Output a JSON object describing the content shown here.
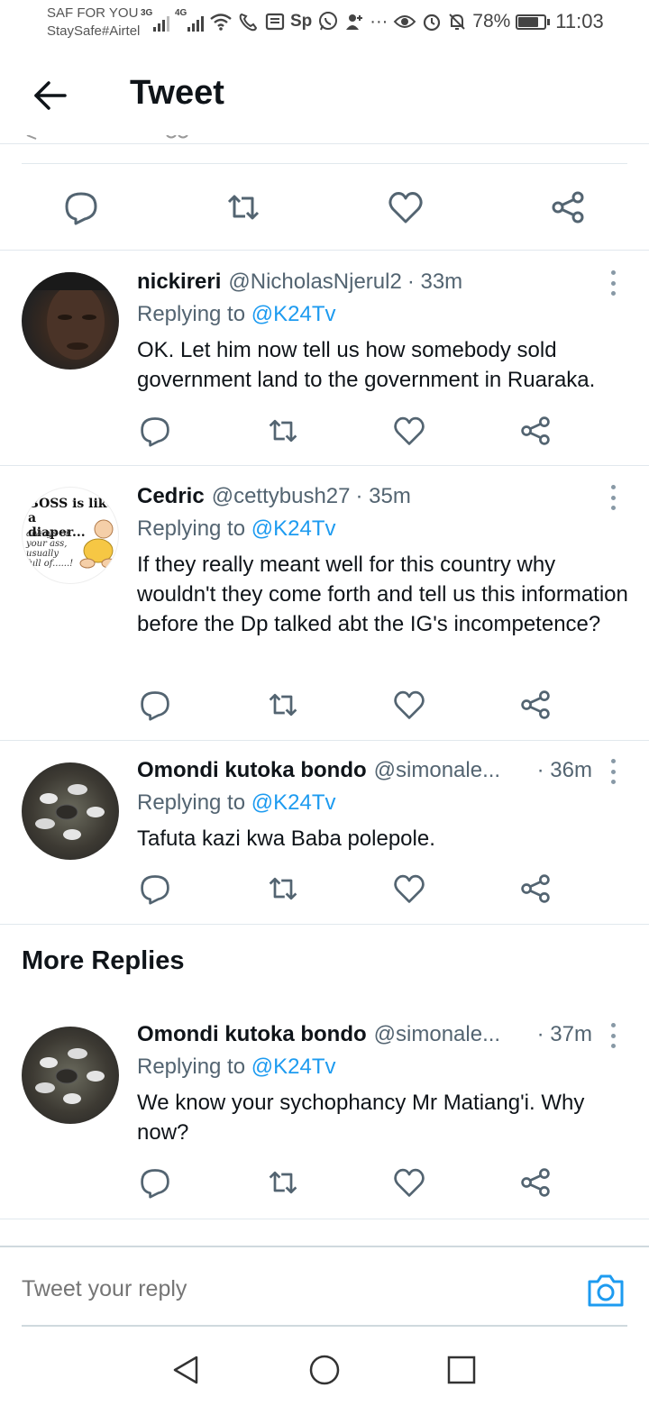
{
  "status_bar": {
    "carrier_line1": "SAF FOR YOU",
    "carrier_line2": "StaySafe#Airtel",
    "net1": "3G",
    "net2": "4G",
    "sp_label": "Sp",
    "more": "···",
    "battery": "78%",
    "time": "11:03"
  },
  "header": {
    "title": "Tweet"
  },
  "tweets": [
    {
      "name": "nickireri",
      "handle": "@NicholasNjerul2",
      "time": "· 33m",
      "replying_label": "Replying to",
      "replying_to": "@K24Tv",
      "text": "OK. Let him now tell us how somebody sold government land to the government in Ruaraka."
    },
    {
      "name": "Cedric",
      "handle": "@cettybush27",
      "time": "· 35m",
      "replying_label": "Replying to",
      "replying_to": "@K24Tv",
      "text": "If they really meant well for this country why wouldn't they come forth and tell us this information before the Dp talked abt the IG's incompetence?",
      "avatar_text_1": "BOSS is like a",
      "avatar_text_2": "diaper...",
      "avatar_text_3": "always on",
      "avatar_text_4": "your ass,",
      "avatar_text_5": "usually",
      "avatar_text_6": "full of......!"
    },
    {
      "name": "Omondi kutoka bondo",
      "handle": "@simonale...",
      "time": "· 36m",
      "replying_label": "Replying to",
      "replying_to": "@K24Tv",
      "text": "Tafuta kazi kwa Baba polepole."
    },
    {
      "name": "Omondi kutoka bondo",
      "handle": "@simonale...",
      "time": "· 37m",
      "replying_label": "Replying to",
      "replying_to": "@K24Tv",
      "text": "We know your sychophancy Mr Matiang'i. Why now?"
    }
  ],
  "more_replies_label": "More Replies",
  "composer": {
    "placeholder": "Tweet your reply"
  },
  "icons": {
    "back": "arrow-left-icon",
    "reply": "reply-icon",
    "retweet": "retweet-icon",
    "like": "heart-icon",
    "share": "share-icon",
    "more": "more-vertical-icon",
    "camera": "camera-icon",
    "nav_back": "triangle-back-icon",
    "nav_home": "circle-home-icon",
    "nav_recents": "square-recents-icon"
  },
  "colors": {
    "accent": "#1d9bf0",
    "text": "#0f1419",
    "muted": "#536471",
    "divider": "#e1e8ed"
  }
}
